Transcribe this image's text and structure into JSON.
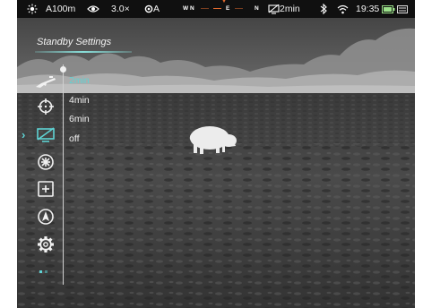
{
  "colors": {
    "accent": "#5fd3d4",
    "text": "#f2f2f2",
    "statusbar_bg": "#101010",
    "compass_mark": "#e26a2e"
  },
  "statusbar": {
    "left_icon": "sun-icon",
    "range": "A100m",
    "eye_icon": "eye-icon",
    "zoom": "3.0×",
    "focus_mode": "A",
    "focus_icon": "lens-icon",
    "compass": {
      "w": "W",
      "n": "N",
      "e": "E",
      "n2": "N"
    },
    "standby_icon": "monitor-off-icon",
    "standby": "2min",
    "bluetooth_icon": "bluetooth-icon",
    "wifi_icon": "wifi-icon",
    "time": "19:35",
    "battery_icon": "battery-icon",
    "card_icon": "card-icon"
  },
  "menu": {
    "title": "Standby Settings",
    "icons": [
      "rifle-icon",
      "crosshair-icon",
      "standby-monitor-icon",
      "palette-icon",
      "plus-box-icon",
      "navigation-icon",
      "settings-gear-icon"
    ],
    "options": [
      "2min",
      "4min",
      "6min",
      "off"
    ],
    "selected_option": "2min"
  }
}
